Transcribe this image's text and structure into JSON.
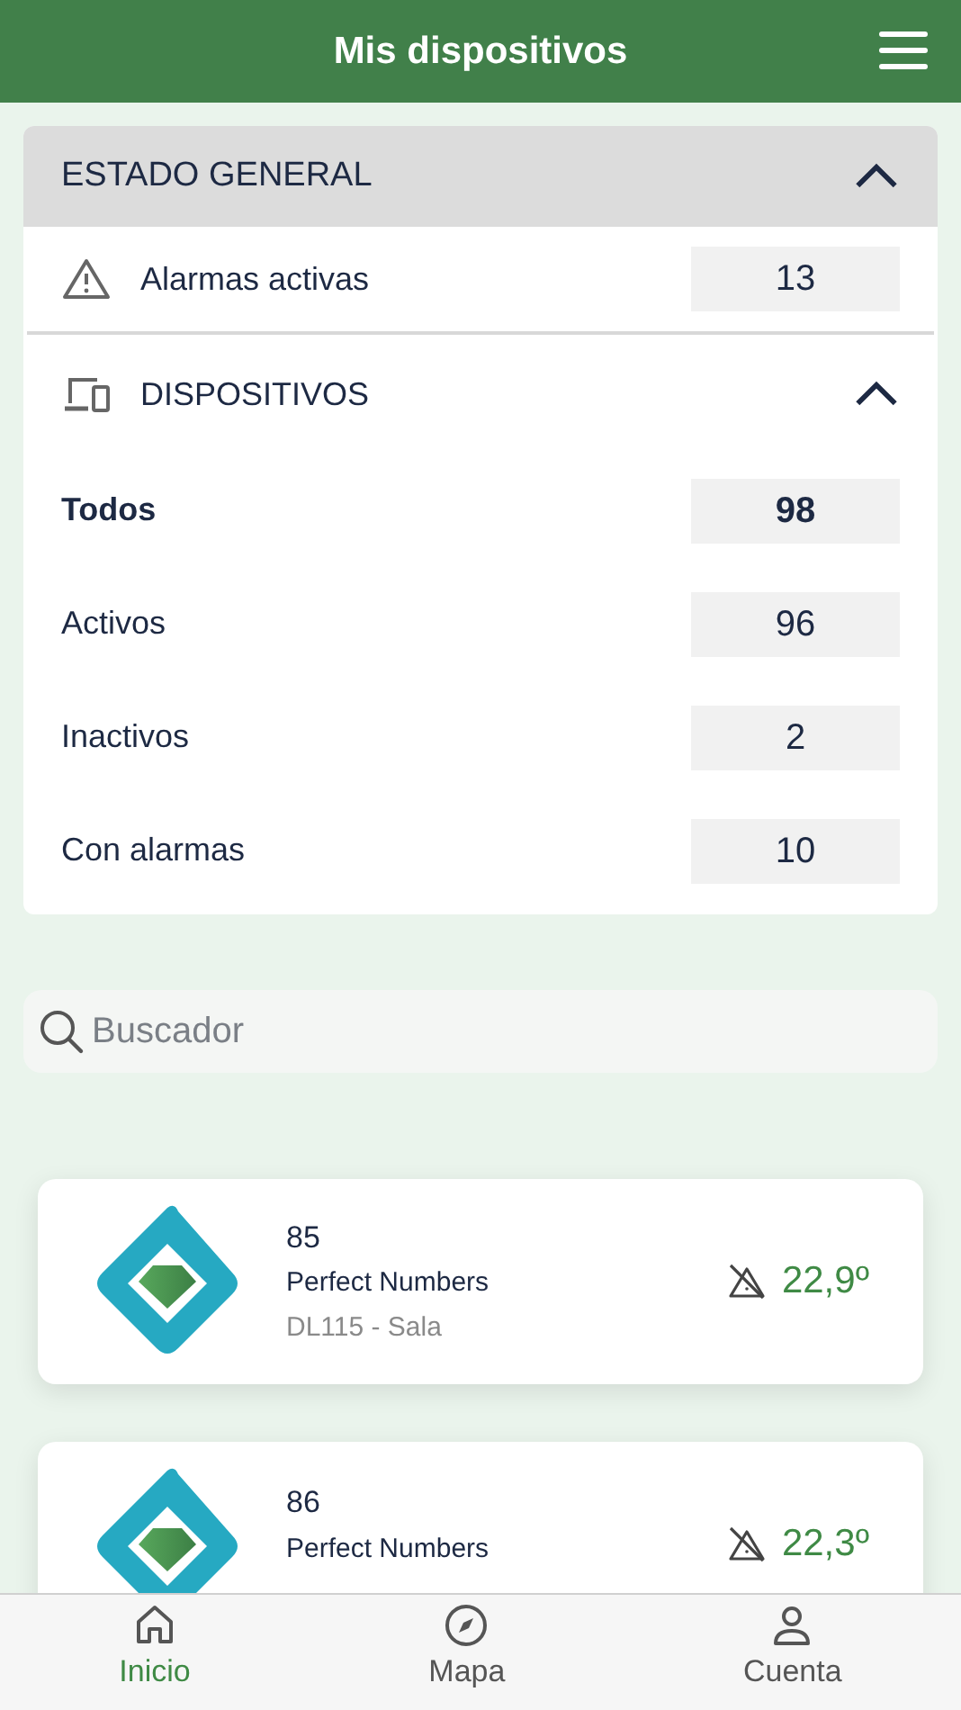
{
  "header": {
    "title": "Mis dispositivos"
  },
  "summary": {
    "title": "ESTADO GENERAL",
    "expanded": true,
    "alarms": {
      "label": "Alarmas activas",
      "count": "13"
    },
    "devices": {
      "title": "DISPOSITIVOS",
      "expanded": true,
      "items": [
        {
          "label": "Todos",
          "count": "98",
          "selected": true
        },
        {
          "label": "Activos",
          "count": "96",
          "selected": false
        },
        {
          "label": "Inactivos",
          "count": "2",
          "selected": false
        },
        {
          "label": "Con alarmas",
          "count": "10",
          "selected": false
        }
      ]
    }
  },
  "search": {
    "placeholder": "Buscador"
  },
  "devices": [
    {
      "number": "85",
      "name": "Perfect Numbers",
      "location": "DL115 - Sala",
      "temperature": "22,9º"
    },
    {
      "number": "86",
      "name": "Perfect Numbers",
      "temperature": "22,3º"
    }
  ],
  "tabs": [
    {
      "label": "Inicio",
      "kind": "home",
      "selected": true
    },
    {
      "label": "Mapa",
      "kind": "map",
      "selected": false
    },
    {
      "label": "Cuenta",
      "kind": "account",
      "selected": false
    }
  ]
}
